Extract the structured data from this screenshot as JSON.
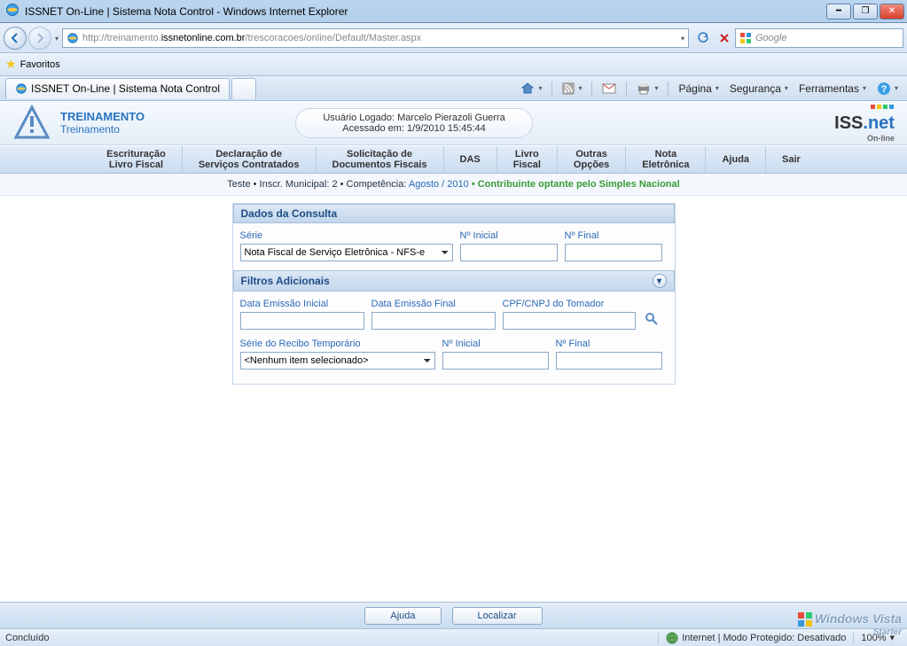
{
  "window": {
    "title": "ISSNET On-Line | Sistema Nota Control - Windows Internet Explorer",
    "url_grey1": "http://treinamento.",
    "url_black": "issnetonline.com.br",
    "url_grey2": "/trescoracoes/online/Default/Master.aspx",
    "search_placeholder": "Google",
    "favorites": "Favoritos",
    "tab_title": "ISSNET On-Line | Sistema Nota Control",
    "cmd_pagina": "Página",
    "cmd_seguranca": "Segurança",
    "cmd_ferramentas": "Ferramentas"
  },
  "header": {
    "train1": "TREINAMENTO",
    "train2": "Treinamento",
    "logged": "Usuário Logado: Marcelo Pierazoli Guerra",
    "accessed": "Acessado em: 1/9/2010 15:45:44",
    "logo_sub": "On-line"
  },
  "menu": {
    "m1a": "Escrituração",
    "m1b": "Livro Fiscal",
    "m2a": "Declaração de",
    "m2b": "Serviços Contratados",
    "m3a": "Solicitação de",
    "m3b": "Documentos Fiscais",
    "m4": "DAS",
    "m5a": "Livro",
    "m5b": "Fiscal",
    "m6a": "Outras",
    "m6b": "Opções",
    "m7a": "Nota",
    "m7b": "Eletrônica",
    "m8": "Ajuda",
    "m9": "Sair"
  },
  "status": {
    "p1": "Teste • Inscr. Municipal: 2 • Competência: ",
    "p2": "Agosto / 2010",
    "p3": " • Contribuinte optante pelo Simples Nacional"
  },
  "form": {
    "head1": "Dados da Consulta",
    "lbl_serie": "Série",
    "lbl_ninicial": "Nº Inicial",
    "lbl_nfinal": "Nº Final",
    "serie_value": "Nota Fiscal de Serviço Eletrônica - NFS-e",
    "head2": "Filtros Adicionais",
    "lbl_data_ini": "Data Emissão Inicial",
    "lbl_data_fim": "Data Emissão Final",
    "lbl_cpf": "CPF/CNPJ do Tomador",
    "lbl_serie_recibo": "Série do Recibo Temporário",
    "recibo_value": "<Nenhum item selecionado>"
  },
  "buttons": {
    "ajuda": "Ajuda",
    "localizar": "Localizar"
  },
  "statusbar": {
    "done": "Concluído",
    "mode": "Internet | Modo Protegido: Desativado",
    "zoom": "100%"
  },
  "vista": "Windows Vista",
  "vista_sub": "Starter"
}
